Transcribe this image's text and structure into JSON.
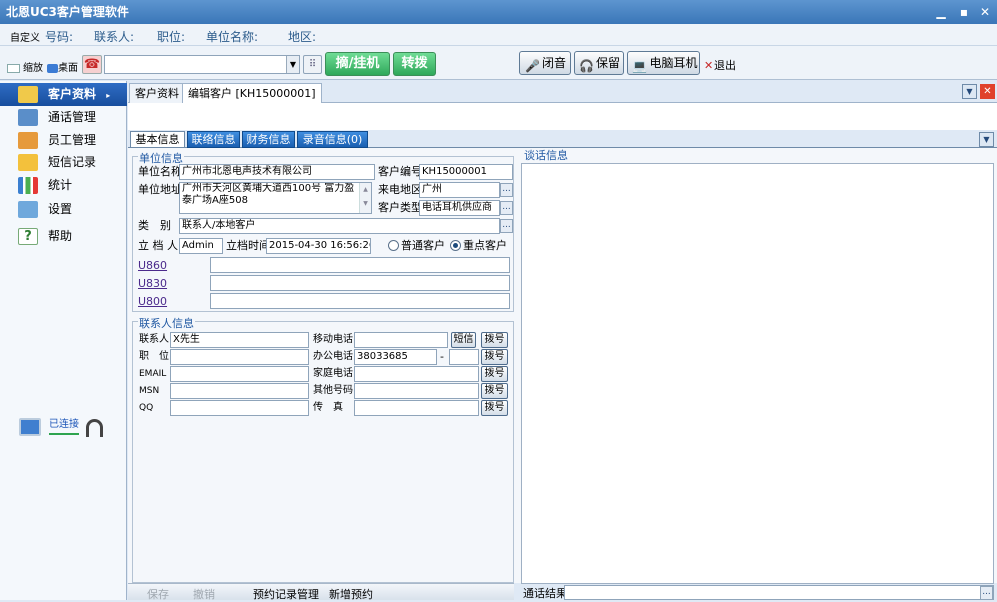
{
  "window": {
    "title": "北恩UC3客户管理软件"
  },
  "infobar": {
    "custom": "自定义",
    "number": "号码:",
    "contact": "联系人:",
    "position": "职位:",
    "company": "单位名称:",
    "region": "地区:"
  },
  "toolbar": {
    "shrink": "缩放",
    "desktop": "桌面",
    "hook": "摘/挂机",
    "transfer": "转拨",
    "mute": "闭音",
    "hold": "保留",
    "headset": "电脑耳机",
    "exit": "退出"
  },
  "sidebar": {
    "items": [
      {
        "label": "客户资料",
        "icon": "contacts-icon"
      },
      {
        "label": "通话管理",
        "icon": "call-icon"
      },
      {
        "label": "员工管理",
        "icon": "staff-icon"
      },
      {
        "label": "短信记录",
        "icon": "mail-icon"
      },
      {
        "label": "统计",
        "icon": "chart-icon"
      },
      {
        "label": "设置",
        "icon": "settings-icon"
      },
      {
        "label": "帮助",
        "icon": "help-icon"
      }
    ],
    "connected": "已连接"
  },
  "tabs": {
    "customer_data": "客户资料",
    "edit_customer": "编辑客户 [KH15000001]"
  },
  "subtabs": [
    "基本信息",
    "联络信息",
    "财务信息",
    "录音信息(0)"
  ],
  "unit": {
    "title": "单位信息",
    "name_label": "单位名称",
    "name": "广州市北恩电声技术有限公司",
    "cust_no_label": "客户编号",
    "cust_no": "KH15000001",
    "address_label": "单位地址",
    "address": "广州市天河区黄埔大道西100号 富力盈泰广场A座508",
    "region_label": "来电地区",
    "region": "广州",
    "type_label": "客户类型",
    "type": "电话耳机供应商",
    "category_label": "类　别",
    "category": "联系人/本地客户",
    "creator_label": "立 档 人",
    "creator": "Admin",
    "time_label": "立档时间",
    "time": "2015-04-30 16:56:26",
    "normal": "普通客户",
    "key": "重点客户",
    "links": [
      "U860",
      "U830",
      "U800"
    ]
  },
  "contact": {
    "title": "联系人信息",
    "contact_label": "联系人",
    "contact": "X先生",
    "position_label": "职　位",
    "email_label": "EMAIL",
    "msn_label": "MSN",
    "qq_label": "QQ",
    "mobile_label": "移动电话",
    "office_label": "办公电话",
    "office": "38033685",
    "home_label": "家庭电话",
    "other_label": "其他号码",
    "fax_label": "传　真",
    "sms": "短信",
    "dial": "拨号",
    "dash": "-"
  },
  "talk": {
    "title": "谈话信息",
    "result_label": "通话结果"
  },
  "bottom": {
    "save": "保存",
    "cancel": "撤销",
    "booking_mgmt": "预约记录管理",
    "new_booking": "新增预约"
  }
}
